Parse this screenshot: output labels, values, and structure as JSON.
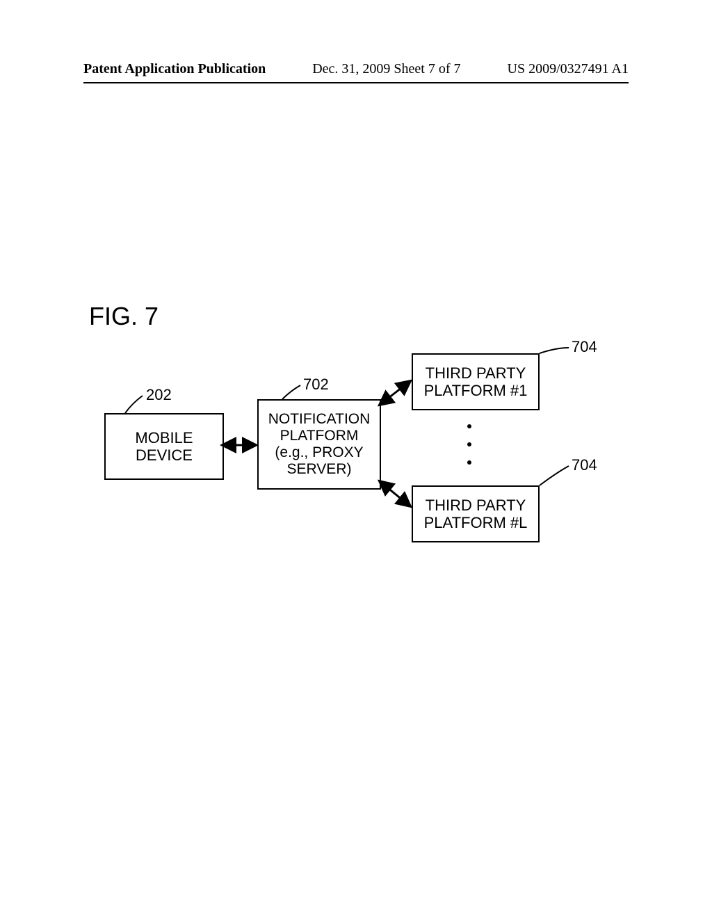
{
  "header": {
    "left": "Patent Application Publication",
    "center": "Dec. 31, 2009  Sheet 7 of 7",
    "right": "US 2009/0327491 A1"
  },
  "figure": {
    "label": "FIG. 7"
  },
  "boxes": {
    "mobile_line1": "MOBILE",
    "mobile_line2": "DEVICE",
    "notif_line1": "NOTIFICATION",
    "notif_line2": "PLATFORM",
    "notif_line3": "(e.g., PROXY",
    "notif_line4": "SERVER)",
    "tp1_line1": "THIRD PARTY",
    "tp1_line2": "PLATFORM #1",
    "tpL_line1": "THIRD PARTY",
    "tpL_line2": "PLATFORM #L"
  },
  "refs": {
    "r202": "202",
    "r702": "702",
    "r704a": "704",
    "r704b": "704"
  }
}
